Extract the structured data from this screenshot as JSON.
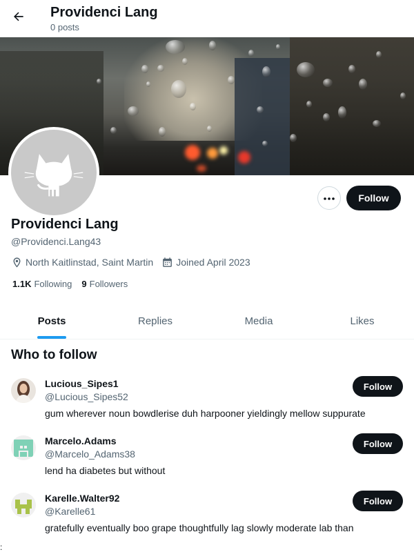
{
  "header": {
    "back_icon": "arrow-left-icon",
    "title": "Providenci Lang",
    "post_count": "0 posts"
  },
  "profile": {
    "banner": "rainy window city lights photo",
    "avatar_icon": "octocat-icon",
    "more_icon": "more-horizontal-icon",
    "follow_label": "Follow",
    "name": "Providenci Lang",
    "handle": "@Providenci.Lang43",
    "location_icon": "location-pin-icon",
    "location": "North Kaitlinstad, Saint Martin",
    "calendar_icon": "calendar-icon",
    "joined": "Joined April 2023",
    "following_count": "1.1K",
    "following_label": "Following",
    "followers_count": "9",
    "followers_label": "Followers"
  },
  "tabs": [
    {
      "label": "Posts",
      "active": true
    },
    {
      "label": "Replies",
      "active": false
    },
    {
      "label": "Media",
      "active": false
    },
    {
      "label": "Likes",
      "active": false
    }
  ],
  "who_to_follow": {
    "title": "Who to follow",
    "suggestions": [
      {
        "name": "Lucious_Sipes1",
        "handle": "@Lucious_Sipes52",
        "bio": "gum wherever noun bowdlerise duh harpooner yieldingly mellow suppurate",
        "follow_label": "Follow"
      },
      {
        "name": "Marcelo.Adams",
        "handle": "@Marcelo_Adams38",
        "bio": "lend ha diabetes but without",
        "follow_label": "Follow"
      },
      {
        "name": "Karelle.Walter92",
        "handle": "@Karelle61",
        "bio": "gratefully eventually boo grape thoughtfully lag slowly moderate lab than",
        "follow_label": "Follow"
      }
    ]
  },
  "stray_text": ":",
  "colors": {
    "accent": "#1d9bf0",
    "button_dark": "#0f1419",
    "muted_text": "#536471",
    "identicon_teal": "#7fd1b6",
    "identicon_olive": "#a9c24a"
  }
}
